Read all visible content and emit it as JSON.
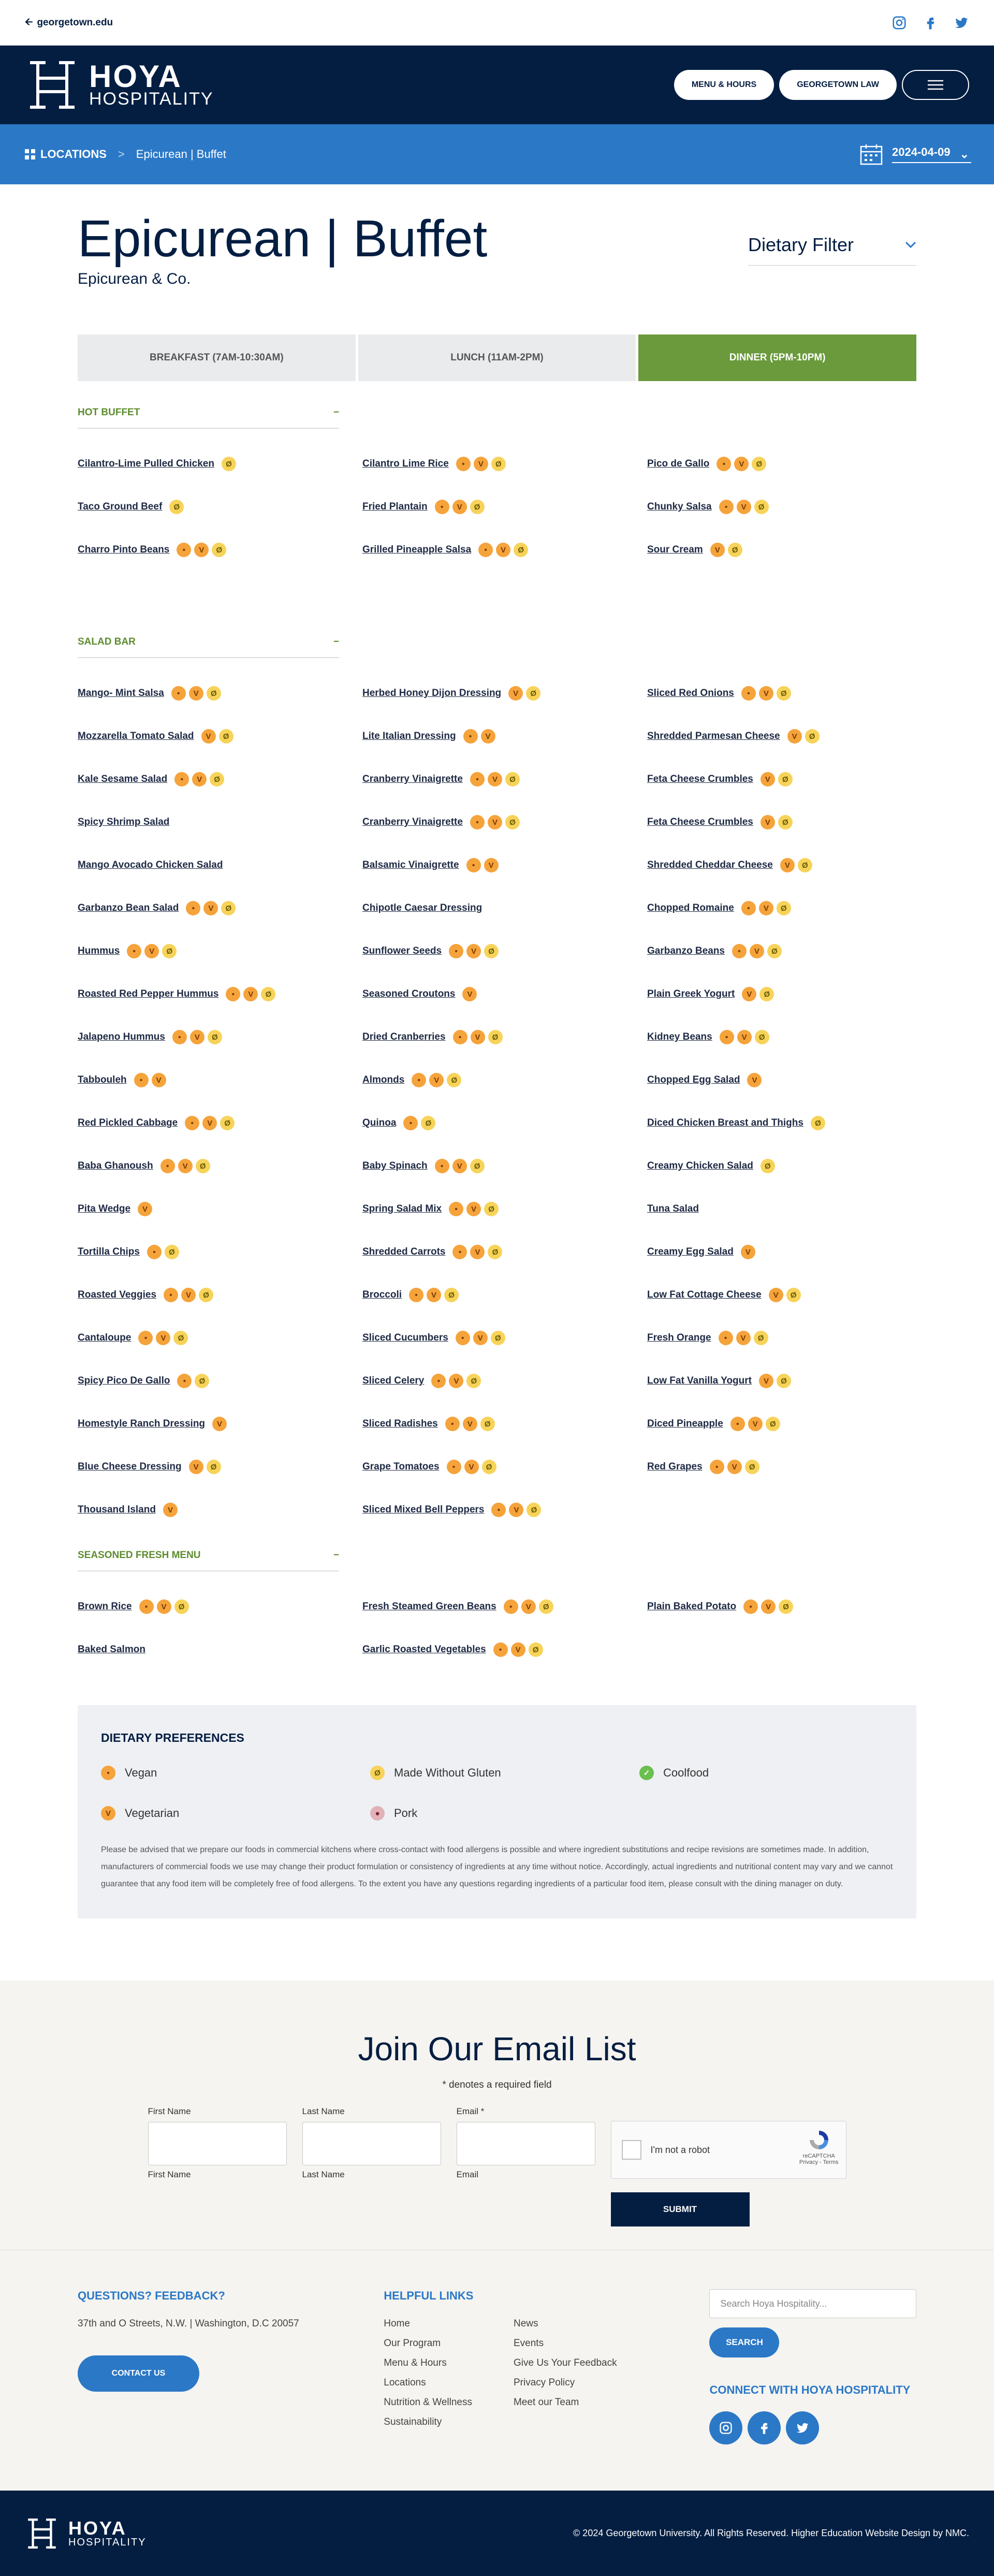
{
  "topbar": {
    "back_label": "georgetown.edu",
    "social": [
      "instagram-icon",
      "facebook-icon",
      "twitter-icon"
    ]
  },
  "header": {
    "brand1": "HOYA",
    "brand2": "HOSPITALITY",
    "btn_menu_hours": "MENU & HOURS",
    "btn_law": "GEORGETOWN LAW"
  },
  "crumbs": {
    "locations": "LOCATIONS",
    "sep": ">",
    "current": "Epicurean | Buffet",
    "date": "2024-04-09"
  },
  "page": {
    "title": "Epicurean | Buffet",
    "subtitle": "Epicurean & Co.",
    "dietary_filter": "Dietary Filter"
  },
  "tabs": [
    "BREAKFAST (7AM-10:30AM)",
    "LUNCH (11AM-2PM)",
    "DINNER (5PM-10PM)"
  ],
  "sections": [
    {
      "title": "HOT BUFFET",
      "items": [
        {
          "name": "Cilantro-Lime Pulled Chicken",
          "icons": [
            "gf"
          ]
        },
        {
          "name": "Cilantro Lime Rice",
          "icons": [
            "vegan",
            "veg",
            "gf"
          ]
        },
        {
          "name": "Pico de Gallo",
          "icons": [
            "vegan",
            "veg",
            "gf"
          ]
        },
        {
          "name": "Taco Ground Beef",
          "icons": [
            "gf"
          ]
        },
        {
          "name": "Fried Plantain",
          "icons": [
            "vegan",
            "veg",
            "gf"
          ]
        },
        {
          "name": "Chunky Salsa",
          "icons": [
            "vegan",
            "veg",
            "gf"
          ]
        },
        {
          "name": "Charro Pinto Beans",
          "icons": [
            "vegan",
            "veg",
            "gf"
          ]
        },
        {
          "name": "Grilled Pineapple Salsa",
          "icons": [
            "vegan",
            "veg",
            "gf"
          ]
        },
        {
          "name": "Sour Cream",
          "icons": [
            "veg",
            "gf"
          ]
        }
      ]
    },
    {
      "title": "SALAD BAR",
      "items": [
        {
          "name": "Mango- Mint Salsa",
          "icons": [
            "vegan",
            "veg",
            "gf"
          ]
        },
        {
          "name": "Herbed Honey Dijon Dressing",
          "icons": [
            "veg",
            "gf"
          ]
        },
        {
          "name": "Sliced Red Onions",
          "icons": [
            "vegan",
            "veg",
            "gf"
          ]
        },
        {
          "name": "Mozzarella Tomato Salad",
          "icons": [
            "veg",
            "gf"
          ]
        },
        {
          "name": "Lite Italian Dressing",
          "icons": [
            "vegan",
            "veg"
          ]
        },
        {
          "name": "Shredded Parmesan Cheese",
          "icons": [
            "veg",
            "gf"
          ]
        },
        {
          "name": "Kale Sesame Salad",
          "icons": [
            "vegan",
            "veg",
            "gf"
          ]
        },
        {
          "name": "Cranberry Vinaigrette",
          "icons": [
            "vegan",
            "veg",
            "gf"
          ]
        },
        {
          "name": "Feta Cheese Crumbles",
          "icons": [
            "veg",
            "gf"
          ]
        },
        {
          "name": "Spicy Shrimp Salad",
          "icons": []
        },
        {
          "name": "Cranberry Vinaigrette",
          "icons": [
            "vegan",
            "veg",
            "gf"
          ]
        },
        {
          "name": "Feta Cheese Crumbles",
          "icons": [
            "veg",
            "gf"
          ]
        },
        {
          "name": "Mango Avocado Chicken Salad",
          "icons": []
        },
        {
          "name": "Balsamic Vinaigrette",
          "icons": [
            "vegan",
            "veg"
          ]
        },
        {
          "name": "Shredded Cheddar Cheese",
          "icons": [
            "veg",
            "gf"
          ]
        },
        {
          "name": "Garbanzo Bean Salad",
          "icons": [
            "vegan",
            "veg",
            "gf"
          ]
        },
        {
          "name": "Chipotle Caesar Dressing",
          "icons": []
        },
        {
          "name": "Chopped Romaine",
          "icons": [
            "vegan",
            "veg",
            "gf"
          ]
        },
        {
          "name": "Hummus",
          "icons": [
            "vegan",
            "veg",
            "gf"
          ]
        },
        {
          "name": "Sunflower Seeds",
          "icons": [
            "vegan",
            "veg",
            "gf"
          ]
        },
        {
          "name": "Garbanzo Beans",
          "icons": [
            "vegan",
            "veg",
            "gf"
          ]
        },
        {
          "name": "Roasted Red Pepper Hummus",
          "icons": [
            "vegan",
            "veg",
            "gf"
          ]
        },
        {
          "name": "Seasoned Croutons",
          "icons": [
            "veg"
          ]
        },
        {
          "name": "Plain Greek Yogurt",
          "icons": [
            "veg",
            "gf"
          ]
        },
        {
          "name": "Jalapeno Hummus",
          "icons": [
            "vegan",
            "veg",
            "gf"
          ]
        },
        {
          "name": "Dried Cranberries",
          "icons": [
            "vegan",
            "veg",
            "gf"
          ]
        },
        {
          "name": "Kidney Beans",
          "icons": [
            "vegan",
            "veg",
            "gf"
          ]
        },
        {
          "name": "Tabbouleh",
          "icons": [
            "vegan",
            "veg"
          ]
        },
        {
          "name": "Almonds",
          "icons": [
            "vegan",
            "veg",
            "gf"
          ]
        },
        {
          "name": "Chopped Egg Salad",
          "icons": [
            "veg"
          ]
        },
        {
          "name": "Red Pickled Cabbage",
          "icons": [
            "vegan",
            "veg",
            "gf"
          ]
        },
        {
          "name": "Quinoa",
          "icons": [
            "vegan",
            "gf"
          ]
        },
        {
          "name": "Diced Chicken Breast and Thighs",
          "icons": [
            "gf"
          ]
        },
        {
          "name": "Baba Ghanoush",
          "icons": [
            "vegan",
            "veg",
            "gf"
          ]
        },
        {
          "name": "Baby Spinach",
          "icons": [
            "vegan",
            "veg",
            "gf"
          ]
        },
        {
          "name": "Creamy Chicken Salad",
          "icons": [
            "gf"
          ]
        },
        {
          "name": "Pita Wedge",
          "icons": [
            "veg"
          ]
        },
        {
          "name": "Spring Salad Mix",
          "icons": [
            "vegan",
            "veg",
            "gf"
          ]
        },
        {
          "name": "Tuna Salad",
          "icons": []
        },
        {
          "name": "Tortilla Chips",
          "icons": [
            "vegan",
            "gf"
          ]
        },
        {
          "name": "Shredded Carrots",
          "icons": [
            "vegan",
            "veg",
            "gf"
          ]
        },
        {
          "name": "Creamy Egg Salad",
          "icons": [
            "veg"
          ]
        },
        {
          "name": "Roasted Veggies",
          "icons": [
            "vegan",
            "veg",
            "gf"
          ]
        },
        {
          "name": "Broccoli",
          "icons": [
            "vegan",
            "veg",
            "gf"
          ]
        },
        {
          "name": "Low Fat Cottage Cheese",
          "icons": [
            "veg",
            "gf"
          ]
        },
        {
          "name": "Cantaloupe",
          "icons": [
            "vegan",
            "veg",
            "gf"
          ]
        },
        {
          "name": "Sliced Cucumbers",
          "icons": [
            "vegan",
            "veg",
            "gf"
          ]
        },
        {
          "name": "Fresh Orange",
          "icons": [
            "vegan",
            "veg",
            "gf"
          ]
        },
        {
          "name": "Spicy Pico De Gallo",
          "icons": [
            "vegan",
            "gf"
          ]
        },
        {
          "name": "Sliced Celery",
          "icons": [
            "vegan",
            "veg",
            "gf"
          ]
        },
        {
          "name": "Low Fat Vanilla Yogurt",
          "icons": [
            "veg",
            "gf"
          ]
        },
        {
          "name": "Homestyle Ranch Dressing",
          "icons": [
            "veg"
          ]
        },
        {
          "name": "Sliced Radishes",
          "icons": [
            "vegan",
            "veg",
            "gf"
          ]
        },
        {
          "name": "Diced Pineapple",
          "icons": [
            "vegan",
            "veg",
            "gf"
          ]
        },
        {
          "name": "Blue Cheese Dressing",
          "icons": [
            "veg",
            "gf"
          ]
        },
        {
          "name": "Grape Tomatoes",
          "icons": [
            "vegan",
            "veg",
            "gf"
          ]
        },
        {
          "name": "Red Grapes",
          "icons": [
            "vegan",
            "veg",
            "gf"
          ]
        },
        {
          "name": "Thousand Island",
          "icons": [
            "veg"
          ]
        },
        {
          "name": "Sliced Mixed Bell Peppers",
          "icons": [
            "vegan",
            "veg",
            "gf"
          ]
        }
      ]
    },
    {
      "title": "SEASONED FRESH MENU",
      "items": [
        {
          "name": "Brown Rice",
          "icons": [
            "vegan",
            "veg",
            "gf"
          ]
        },
        {
          "name": "Fresh Steamed Green Beans",
          "icons": [
            "vegan",
            "veg",
            "gf"
          ]
        },
        {
          "name": "Plain Baked Potato",
          "icons": [
            "vegan",
            "veg",
            "gf"
          ]
        },
        {
          "name": "Baked Salmon",
          "icons": []
        },
        {
          "name": "Garlic Roasted Vegetables",
          "icons": [
            "vegan",
            "veg",
            "gf"
          ]
        }
      ]
    }
  ],
  "prefs": {
    "title": "DIETARY PREFERENCES",
    "items": [
      {
        "k": "vegan",
        "label": "Vegan"
      },
      {
        "k": "gf",
        "label": "Made Without Gluten"
      },
      {
        "k": "cool",
        "label": "Coolfood"
      },
      {
        "k": "veg",
        "label": "Vegetarian"
      },
      {
        "k": "pork",
        "label": "Pork"
      }
    ],
    "disclaimer": "Please be advised that we prepare our foods in commercial kitchens where cross-contact with food allergens is possible and where ingredient substitutions and recipe revisions are sometimes made. In addition, manufacturers of commercial foods we use may change their product formulation or consistency of ingredients at any time without notice. Accordingly, actual ingredients and nutritional content may vary and we cannot guarantee that any food item will be completely free of food allergens. To the extent you have any questions regarding ingredients of a particular food item, please consult with the dining manager on duty."
  },
  "email": {
    "title": "Join Our Email List",
    "required": "* denotes a required field",
    "first": "First Name",
    "last": "Last Name",
    "email": "Email *",
    "email_sub": "Email",
    "captcha": "I'm not a robot",
    "recaptcha": "reCAPTCHA",
    "privacy": "Privacy - Terms",
    "submit": "SUBMIT"
  },
  "footer": {
    "q_title": "QUESTIONS? FEEDBACK?",
    "address": "37th and O Streets, N.W. | Washington, D.C 20057",
    "contact": "CONTACT US",
    "helpful": "HELPFUL LINKS",
    "links1": [
      "Home",
      "Our Program",
      "Menu & Hours",
      "Locations",
      "Nutrition & Wellness",
      "Sustainability"
    ],
    "links2": [
      "News",
      "Events",
      "Give Us Your Feedback",
      "Privacy Policy",
      "Meet our Team"
    ],
    "search_placeholder": "Search Hoya Hospitality...",
    "search_btn": "SEARCH",
    "connect": "CONNECT WITH HOYA HOSPITALITY",
    "copyright": "© 2024 Georgetown University. All Rights Reserved. Higher Education Website Design by NMC."
  }
}
